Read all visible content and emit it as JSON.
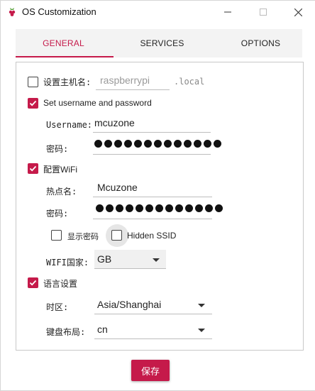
{
  "window": {
    "title": "OS Customization"
  },
  "tabs": [
    {
      "label": "GENERAL",
      "active": true
    },
    {
      "label": "SERVICES",
      "active": false
    },
    {
      "label": "OPTIONS",
      "active": false
    }
  ],
  "accent_color": "#c51a4a",
  "general": {
    "hostname": {
      "checkbox_label": "设置主机名:",
      "checked": false,
      "value": "raspberrypi",
      "suffix": ".local"
    },
    "user": {
      "checkbox_label": "Set username and password",
      "checked": true,
      "username_label": "Username:",
      "username_value": "mcuzone",
      "password_label": "密码:",
      "password_dots": 13
    },
    "wifi": {
      "checkbox_label": "配置WiFi",
      "checked": true,
      "ssid_label": "热点名:",
      "ssid_value": "Mcuzone",
      "password_label": "密码:",
      "password_dots": 13,
      "show_password_label": "显示密码",
      "show_password_checked": false,
      "hidden_ssid_label": "Hidden SSID",
      "hidden_ssid_checked": false,
      "country_label": "WIFI国家:",
      "country_value": "GB"
    },
    "locale": {
      "checkbox_label": "语言设置",
      "checked": true,
      "timezone_label": "时区:",
      "timezone_value": "Asia/Shanghai",
      "keyboard_label": "键盘布局:",
      "keyboard_value": "cn"
    }
  },
  "footer": {
    "save_label": "保存"
  }
}
